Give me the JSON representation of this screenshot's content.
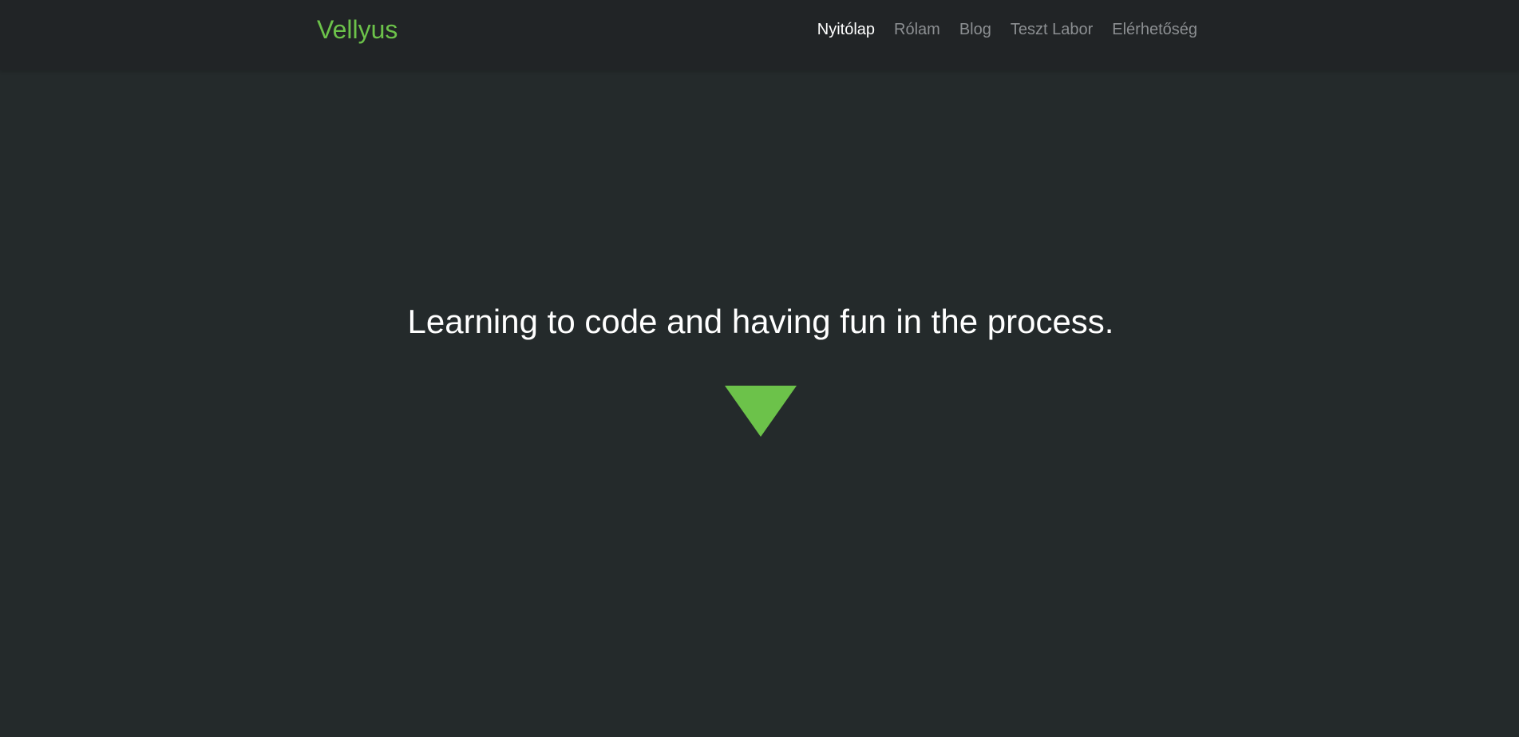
{
  "brand": {
    "name": "Vellyus"
  },
  "nav": {
    "items": [
      {
        "label": "Nyitólap",
        "active": true
      },
      {
        "label": "Rólam"
      },
      {
        "label": "Blog"
      },
      {
        "label": "Teszt Labor"
      },
      {
        "label": "Elérhetőség"
      }
    ]
  },
  "hero": {
    "tagline": "Learning to code and having fun in the process.",
    "scroll_icon": "triangle-down-icon"
  },
  "colors": {
    "accent": "#6cc24a",
    "navbar_bg": "#212426",
    "page_bg": "#242a2b",
    "nav_text": "#8c8f92",
    "nav_active": "#ffffff"
  }
}
